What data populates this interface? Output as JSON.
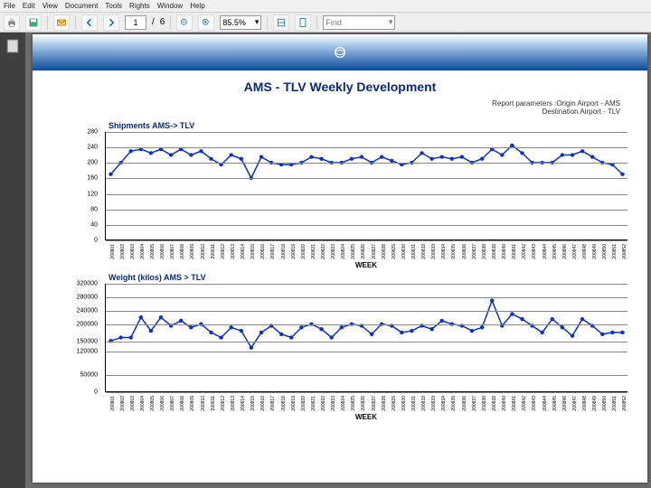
{
  "menubar": {
    "items": [
      "File",
      "Edit",
      "View",
      "Document",
      "Tools",
      "Rights",
      "Window",
      "Help"
    ]
  },
  "toolbar": {
    "page_current": "1",
    "page_sep": "/",
    "page_total": "6",
    "zoom": "85.5%",
    "find_placeholder": "Find"
  },
  "report": {
    "title": "AMS - TLV Weekly Development",
    "params": "Report parameters :Origin Airport - AMS\nDestination Airport - TLV",
    "xlabel": "WEEK"
  },
  "chart_data": [
    {
      "type": "line",
      "title": "Shipments AMS-> TLV",
      "xlabel": "WEEK",
      "ylabel": "",
      "ylim": [
        0,
        280
      ],
      "yticks": [
        0,
        40,
        80,
        120,
        160,
        200,
        240,
        280
      ],
      "categories": [
        "200801",
        "200802",
        "200803",
        "200804",
        "200805",
        "200806",
        "200807",
        "200808",
        "200809",
        "200810",
        "200811",
        "200812",
        "200813",
        "200814",
        "200815",
        "200816",
        "200817",
        "200818",
        "200819",
        "200820",
        "200821",
        "200822",
        "200823",
        "200824",
        "200825",
        "200826",
        "200827",
        "200828",
        "200829",
        "200830",
        "200831",
        "200832",
        "200833",
        "200834",
        "200835",
        "200836",
        "200837",
        "200838",
        "200839",
        "200840",
        "200841",
        "200842",
        "200843",
        "200844",
        "200845",
        "200846",
        "200847",
        "200848",
        "200849",
        "200850",
        "200851",
        "200852"
      ],
      "series": [
        {
          "name": "Shipments",
          "values": [
            170,
            200,
            230,
            235,
            225,
            235,
            220,
            235,
            220,
            230,
            210,
            195,
            220,
            210,
            160,
            215,
            200,
            195,
            195,
            200,
            215,
            210,
            200,
            200,
            210,
            215,
            200,
            215,
            205,
            195,
            200,
            225,
            210,
            215,
            210,
            215,
            200,
            210,
            235,
            220,
            245,
            225,
            200,
            200,
            200,
            220,
            220,
            230,
            215,
            200,
            195,
            170
          ]
        }
      ]
    },
    {
      "type": "line",
      "title": "Weight (kilos) AMS > TLV",
      "xlabel": "WEEK",
      "ylabel": "",
      "ylim": [
        0,
        320000
      ],
      "yticks": [
        0,
        50000,
        120000,
        150000,
        200000,
        240000,
        280000,
        320000
      ],
      "categories": [
        "200801",
        "200802",
        "200803",
        "200804",
        "200805",
        "200806",
        "200807",
        "200808",
        "200809",
        "200810",
        "200811",
        "200812",
        "200813",
        "200814",
        "200815",
        "200816",
        "200817",
        "200818",
        "200819",
        "200820",
        "200821",
        "200822",
        "200823",
        "200824",
        "200825",
        "200826",
        "200827",
        "200828",
        "200829",
        "200830",
        "200831",
        "200832",
        "200833",
        "200834",
        "200835",
        "200836",
        "200837",
        "200838",
        "200839",
        "200840",
        "200841",
        "200842",
        "200843",
        "200844",
        "200845",
        "200846",
        "200847",
        "200848",
        "200849",
        "200850",
        "200851",
        "200852"
      ],
      "series": [
        {
          "name": "Weight",
          "values": [
            150000,
            160000,
            160000,
            220000,
            180000,
            220000,
            195000,
            210000,
            190000,
            200000,
            175000,
            160000,
            190000,
            180000,
            130000,
            175000,
            195000,
            170000,
            160000,
            190000,
            200000,
            185000,
            160000,
            190000,
            200000,
            195000,
            170000,
            200000,
            195000,
            175000,
            180000,
            195000,
            185000,
            210000,
            200000,
            195000,
            180000,
            190000,
            270000,
            195000,
            230000,
            215000,
            195000,
            175000,
            215000,
            190000,
            165000,
            215000,
            195000,
            170000,
            175000,
            175000
          ]
        }
      ]
    }
  ]
}
